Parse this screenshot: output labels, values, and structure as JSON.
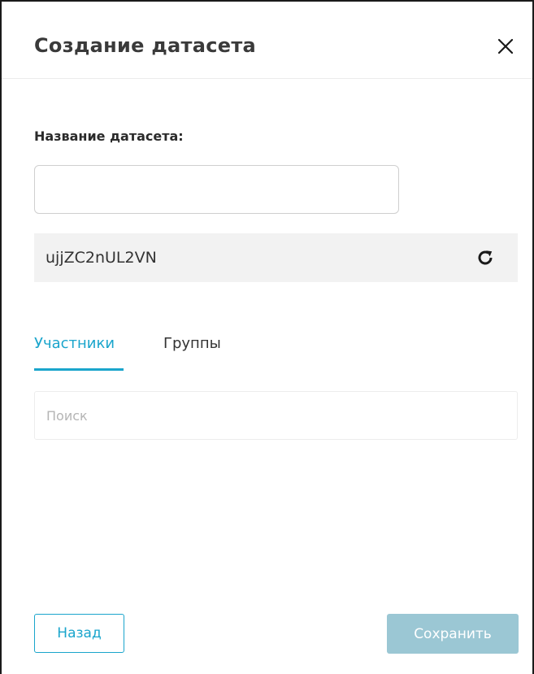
{
  "dialog": {
    "title": "Создание датасета",
    "close_icon": "close-icon"
  },
  "form": {
    "name_label": "Название датасета:",
    "name_value": "",
    "generated_id": "ujjZC2nUL2VN",
    "refresh_icon": "refresh-icon"
  },
  "tabs": [
    {
      "label": "Участники",
      "active": true
    },
    {
      "label": "Группы",
      "active": false
    }
  ],
  "search": {
    "placeholder": "Поиск",
    "value": ""
  },
  "footer": {
    "back_label": "Назад",
    "save_label": "Сохранить",
    "save_enabled": false
  },
  "colors": {
    "accent": "#1aa5cc",
    "save_disabled_bg": "#9bc7d4",
    "id_bar_bg": "#f2f2f2",
    "title_text": "#3a3a3a"
  }
}
